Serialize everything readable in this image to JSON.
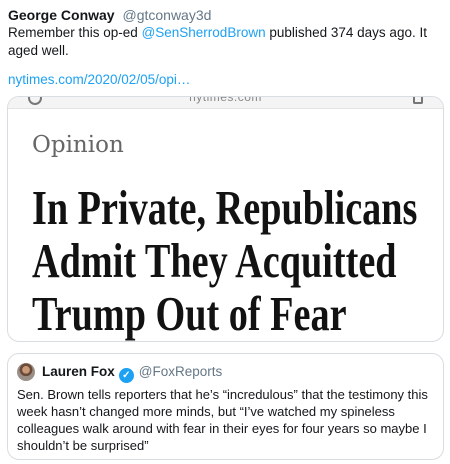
{
  "tweet": {
    "author_name": "George Conway",
    "author_handle": "@gtconway3d",
    "text_before_mention": "Remember this op-ed ",
    "mention": "@SenSherrodBrown",
    "text_after_mention": " published 374 days ago.  It aged well.",
    "link": "nytimes.com/2020/02/05/opi…"
  },
  "card": {
    "site_label": "nytimes.com",
    "section": "Opinion",
    "headline_lines": [
      "In Private, Republicans",
      "Admit They Acquitted",
      "Trump Out of Fear"
    ]
  },
  "quoted_tweet": {
    "author_name": "Lauren Fox",
    "verified_mark": "✓",
    "author_handle": "@FoxReports",
    "text": "Sen. Brown tells reporters that he’s “incredulous” that the testimony this week hasn’t changed more minds, but  “I’ve watched my spineless colleagues walk around with fear in their eyes for four years so maybe I shouldn’t be surprised”"
  },
  "colors": {
    "link_blue": "#1da1f2",
    "secondary_text": "#657786"
  }
}
